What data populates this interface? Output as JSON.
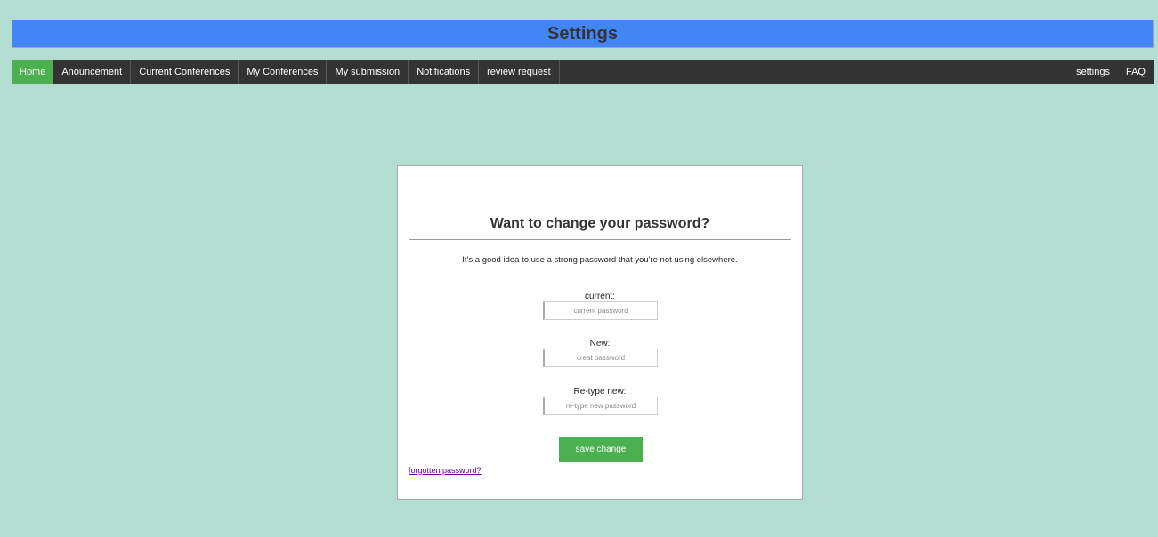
{
  "header": {
    "title": "Settings"
  },
  "nav": {
    "left_items": [
      {
        "label": "Home",
        "active": true
      },
      {
        "label": "Anouncement"
      },
      {
        "label": "Current Conferences"
      },
      {
        "label": "My Conferences"
      },
      {
        "label": "My submission"
      },
      {
        "label": "Notifications"
      },
      {
        "label": "review request"
      }
    ],
    "right_items": [
      {
        "label": "settings"
      },
      {
        "label": "FAQ"
      }
    ]
  },
  "card": {
    "heading": "Want to change your password?",
    "subtitle": "It's a good idea to use a strong password that you're not using elsewhere.",
    "fields": [
      {
        "label": "current:",
        "placeholder": "current password",
        "value": ""
      },
      {
        "label": "New:",
        "placeholder": "creat password",
        "value": ""
      },
      {
        "label": "Re-type new:",
        "placeholder": "re-type new password",
        "value": ""
      }
    ],
    "save_label": "save change",
    "forgot_label": "forgotten password?"
  },
  "colors": {
    "page_background": "#b3ddd0",
    "title_bar": "#4285f4",
    "nav_background": "#333333",
    "accent_green": "#4caf50",
    "link_visited": "#660099"
  }
}
